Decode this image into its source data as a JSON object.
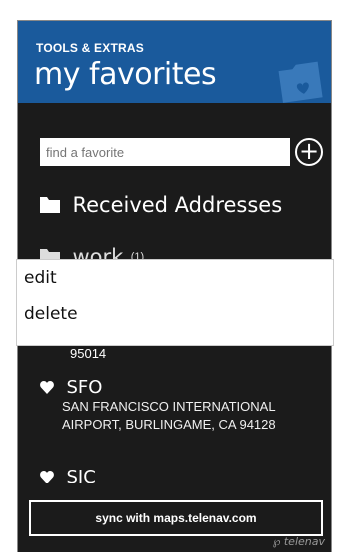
{
  "header": {
    "subtitle": "TOOLS & EXTRAS",
    "title": "my favorites"
  },
  "search": {
    "placeholder": "find a favorite"
  },
  "folders": [
    {
      "label": "Received Addresses"
    },
    {
      "label": "work",
      "count": "(1)"
    }
  ],
  "context_menu": {
    "items": [
      {
        "label": "edit"
      },
      {
        "label": "delete"
      }
    ]
  },
  "partial_address": "95014",
  "favorites": [
    {
      "name": "SFO",
      "address_line1": "SAN FRANCISCO INTERNATIONAL",
      "address_line2": "AIRPORT, BURLINGAME, CA 94128"
    },
    {
      "name": "SJC"
    }
  ],
  "footer": {
    "sync_label": "sync with maps.telenav.com",
    "brand": "telenav"
  },
  "colors": {
    "header_bg": "#1a5a9c",
    "screen_bg": "#1b1b1b",
    "menu_bg": "#ffffff"
  }
}
